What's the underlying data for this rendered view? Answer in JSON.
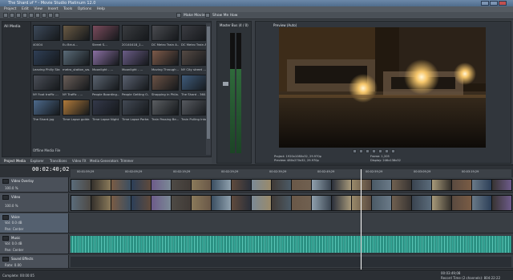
{
  "window": {
    "title": "The Shard.vf * - Movie Studio Platinum 12.0"
  },
  "menu": [
    "Project",
    "Edit",
    "View",
    "Insert",
    "Tools",
    "Options",
    "Help"
  ],
  "toolbar": {
    "make_movie": "Make Movie",
    "show_me_how": "Show Me How"
  },
  "explorer": {
    "tree_root": "All Media",
    "clips": [
      {
        "label": "40004",
        "color": "#3d4a5a"
      },
      {
        "label": "Eu Briut...",
        "color": "#6a5a44"
      },
      {
        "label": "Street S...",
        "color": "#7a4b5c"
      },
      {
        "label": "20140418_1...",
        "color": "#3a3c40"
      },
      {
        "label": "DC Metro Train A...",
        "color": "#4a4b50"
      },
      {
        "label": "DC Metro Train A...",
        "color": "#3b3c42"
      },
      {
        "label": "Leaving Philly Sta...",
        "color": "#2f3f56"
      },
      {
        "label": "metro_station_sw...",
        "color": "#5a6b78"
      },
      {
        "label": "Moonlight - ...",
        "color": "#8a6fa2"
      },
      {
        "label": "Moonlight - ...",
        "color": "#6a5c86"
      },
      {
        "label": "Moving Through ...",
        "color": "#7d5a49"
      },
      {
        "label": "NY City street ...",
        "color": "#554a44"
      },
      {
        "label": "NY Foot traffic ...",
        "color": "#4b4f58"
      },
      {
        "label": "NY Traffic - ...",
        "color": "#6a5e58"
      },
      {
        "label": "People Boarding...",
        "color": "#5b6470"
      },
      {
        "label": "People Getting O...",
        "color": "#5a6170"
      },
      {
        "label": "Shopping in Phila...",
        "color": "#6b5245"
      },
      {
        "label": "The Shard - 360...",
        "color": "#3f5b7a"
      },
      {
        "label": "The Shard.jpg",
        "color": "#4d6a8c"
      },
      {
        "label": "Time Lapse golde...",
        "color": "#b07a3a"
      },
      {
        "label": "Time Lapse Night ...",
        "color": "#34394a"
      },
      {
        "label": "Time Lapse Parke...",
        "color": "#434a55"
      },
      {
        "label": "Train Passing Be...",
        "color": "#5b5e62"
      },
      {
        "label": "Train Pulling Into ...",
        "color": "#575a60"
      }
    ],
    "offline": "Offline Media File",
    "tabs": [
      "Project Media",
      "Explorer",
      "Transitions",
      "Video FX",
      "Media Generators",
      "Trimmer"
    ]
  },
  "master": {
    "label": "Master Bus (4 / 0)"
  },
  "preview": {
    "label": "Preview (Auto)",
    "project": "Project: 1920x1080x32, 29.970p",
    "preview_res": "Preview: 480x270x32, 29.970p",
    "frame": "Frame: 1,205",
    "display": "Display: 246x138x32"
  },
  "timeline": {
    "timecode": "00:02:40;02",
    "ruler": [
      "00:01:59;29",
      "00:02:09;29",
      "00:02:19;29",
      "00:02:29;29",
      "00:02:39;29",
      "00:02:49;29",
      "00:02:59;29",
      "00:03:09;29",
      "00:03:19;29"
    ],
    "tracks": [
      {
        "name": "Video Overlay",
        "level": "100.0 %"
      },
      {
        "name": "Video",
        "level": "100.0 %"
      },
      {
        "name": "Voice",
        "vol": "Vol: 0.0 dB",
        "pan": "Pan: Center"
      },
      {
        "name": "Music",
        "vol": "Vol: 0.0 dB",
        "pan": "Pan: Center"
      },
      {
        "name": "Sound Effects"
      }
    ],
    "rate": "Rate: 0.00"
  },
  "status": {
    "complete": "Complete: 00:00:05",
    "record_time": "Record Time (2 channels): 804:22:22",
    "end": "00:03:49;08"
  }
}
